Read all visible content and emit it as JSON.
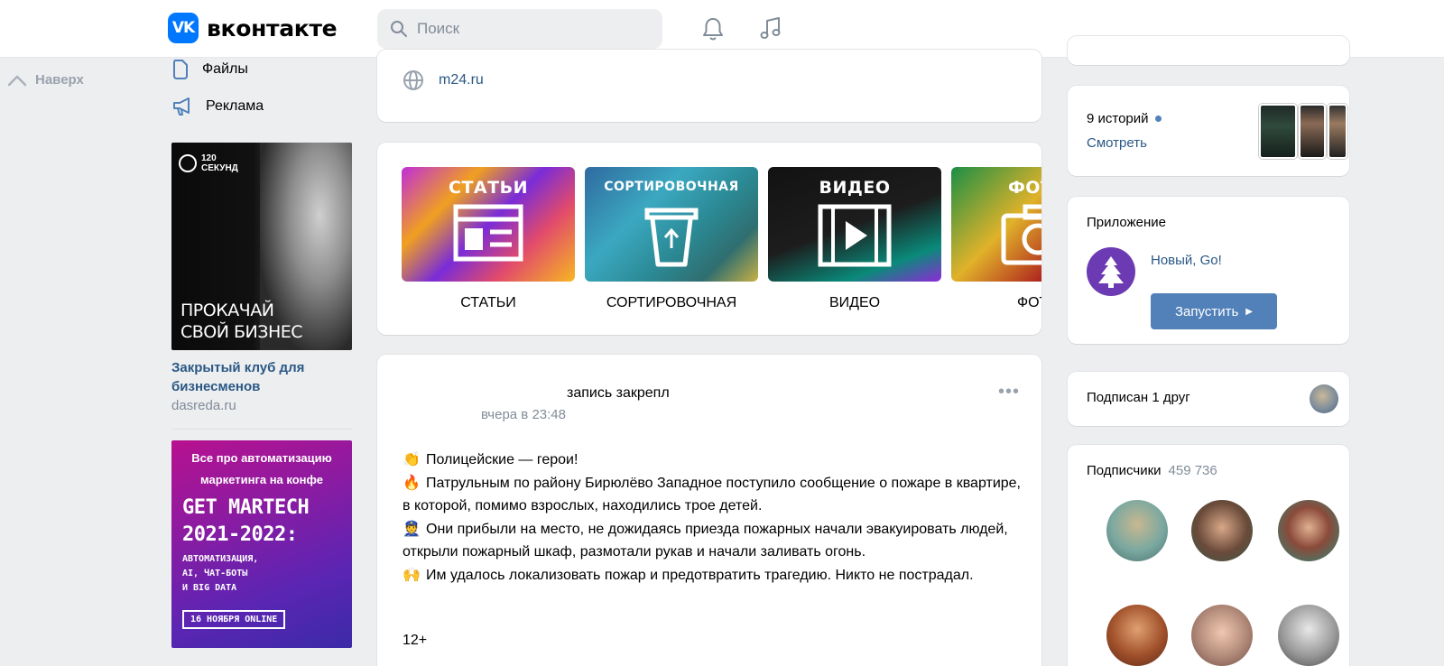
{
  "header": {
    "logo_letters": "VK",
    "logo_text": "вконтакте",
    "search_placeholder": "Поиск"
  },
  "left": {
    "up_label": "Наверх",
    "nav": [
      {
        "label": "Файлы",
        "icon": "file-icon"
      },
      {
        "label": "Реклама",
        "icon": "megaphone-icon"
      }
    ],
    "ads": [
      {
        "image_brand_line1": "120",
        "image_brand_line2": "СЕКУНД",
        "image_headline_line1": "ПРОКАЧАЙ",
        "image_headline_line2": "СВОЙ БИЗНЕС",
        "title": "Закрытый клуб для бизнесменов",
        "domain": "dasreda.ru"
      },
      {
        "image_top_line1": "Все про автоматизацию",
        "image_top_line2": "маркетинга на конфе",
        "image_big_line1": "GET MARTECH",
        "image_big_line2": "2021-2022:",
        "image_small_line1": "АВТОМАТИЗАЦИЯ,",
        "image_small_line2": "AI, ЧАТ-БОТЫ",
        "image_small_line3": "И BIG DATA",
        "image_date": "16 НОЯБРЯ ONLINE"
      }
    ]
  },
  "center": {
    "link_url": "m24.ru",
    "tiles": [
      {
        "image_label": "СТАТЬИ",
        "label": "СТАТЬИ"
      },
      {
        "image_label": "СОРТИРОВОЧНАЯ",
        "label": "СОРТИРОВОЧНАЯ"
      },
      {
        "image_label": "ВИДЕО",
        "label": "ВИДЕО"
      },
      {
        "image_label": "ФОТО",
        "label": "ФОТО"
      }
    ],
    "post": {
      "author_line": "запись закрепл",
      "time": "вчера в 23:48",
      "more": "•••",
      "lines": [
        "Полицейские — герои!",
        "Патрульным по району Бирюлёво Западное поступило сообщение о пожаре в квартире, в которой, помимо взрослых, находились трое детей.",
        "Они прибыли на место, не дожидаясь приезда пожарных начали эвакуировать людей, открыли пожарный шкаф, размотали рукав и начали заливать огонь.",
        "Им удалось локализовать пожар и предотвратить трагедию. Никто не пострадал."
      ],
      "age": "12+"
    }
  },
  "right": {
    "stories": {
      "title": "9 историй",
      "link": "Смотреть"
    },
    "app": {
      "title": "Приложение",
      "name": "Новый, Go!",
      "button": "Запустить",
      "button_caret": "▶"
    },
    "friends": {
      "text": "Подписан 1 друг"
    },
    "subscribers": {
      "title": "Подписчики",
      "count": "459 736"
    }
  },
  "colors": {
    "accent": "#0077ff",
    "link": "#2a5885",
    "button": "#5181b8",
    "muted": "#818c99",
    "page_bg": "#edeef0"
  }
}
